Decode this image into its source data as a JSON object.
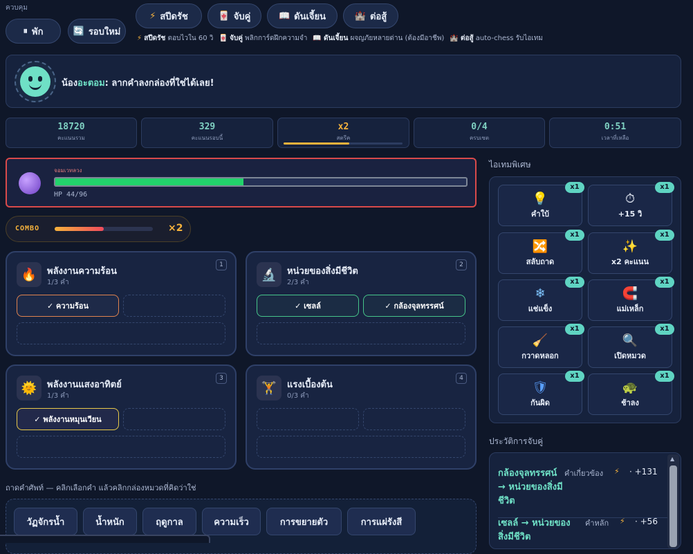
{
  "controls": {
    "label": "ควบคุม",
    "pause": "พัก",
    "restart": "รอบใหม่"
  },
  "modes": [
    {
      "icon": "⚡",
      "label": "สปีดรัช"
    },
    {
      "icon": "🀄",
      "label": "จับคู่"
    },
    {
      "icon": "📖",
      "label": "ดันเจี้ยน"
    },
    {
      "icon": "🏰",
      "label": "ต่อสู้"
    }
  ],
  "mode_hints": [
    {
      "icon": "⚡",
      "name": "สปีดรัช",
      "desc": "ตอบไวใน 60 วิ"
    },
    {
      "icon": "🀄",
      "name": "จับคู่",
      "desc": "พลิกการ์ดฝึกความจำ"
    },
    {
      "icon": "📖",
      "name": "ดันเจี้ยน",
      "desc": "ผจญภัยหลายด่าน (ต้องมีอาชีพ)"
    },
    {
      "icon": "🏰",
      "name": "ต่อสู้",
      "desc": "auto-chess รับไอเทม"
    }
  ],
  "mascot": {
    "prefix": "น้อง",
    "name": "อะตอม",
    "message": ": ลากคำลงกล่องที่ใช่ได้เลย!"
  },
  "stats": [
    {
      "value": "18720",
      "label": "คะแนนรวม"
    },
    {
      "value": "329",
      "label": "คะแนนรอบนี้"
    },
    {
      "value": "x2",
      "label": "สตรีค",
      "progress": 0.55
    },
    {
      "value": "0/4",
      "label": "ครบเซต"
    },
    {
      "value": "0:51",
      "label": "เวลาที่เหลือ"
    }
  ],
  "boss": {
    "name": "จอมเวทลวง",
    "hp": "HP 44/96",
    "hp_fraction": 0.458
  },
  "combo": {
    "label": "COMBO",
    "multiplier": "×2",
    "fraction": 0.5
  },
  "categories": [
    {
      "num": "1",
      "icon": "🔥",
      "title": "พลังงานความร้อน",
      "count": "1/3 คำ",
      "filled": [
        "✓ ความร้อน"
      ]
    },
    {
      "num": "2",
      "icon": "🔬",
      "title": "หน่วยของสิ่งมีชีวิต",
      "count": "2/3 คำ",
      "filled": [
        "✓ เซลล์",
        "✓ กล้องจุลทรรศน์"
      ]
    },
    {
      "num": "3",
      "icon": "🌞",
      "title": "พลังงานแสงอาทิตย์",
      "count": "1/3 คำ",
      "filled": [
        "✓ พลังงานหมุนเวียน"
      ]
    },
    {
      "num": "4",
      "icon": "🏋",
      "title": "แรงเบื้องต้น",
      "count": "0/3 คำ",
      "filled": []
    }
  ],
  "items_title": "ไอเทมพิเศษ",
  "items": [
    {
      "icon": "💡",
      "label": "คำใบ้",
      "count": "x1"
    },
    {
      "icon": "⏱",
      "label": "+15 วิ",
      "count": "x1"
    },
    {
      "icon": "🔀",
      "label": "สลับถาด",
      "count": "x1"
    },
    {
      "icon": "✨",
      "label": "x2 คะแนน",
      "count": "x1"
    },
    {
      "icon": "❄",
      "label": "แช่แข็ง",
      "count": "x1"
    },
    {
      "icon": "🧲",
      "label": "แม่เหล็ก",
      "count": "x1"
    },
    {
      "icon": "🧹",
      "label": "กวาดหลอก",
      "count": "x1"
    },
    {
      "icon": "🔍",
      "label": "เปิดหมวด",
      "count": "x1"
    },
    {
      "icon": "🛡",
      "label": "กันผิด",
      "count": "x1"
    },
    {
      "icon": "🐢",
      "label": "ช้าลง",
      "count": "x1"
    }
  ],
  "history_title": "ประวัติการจับคู่",
  "history": [
    {
      "match": "กล้องจุลทรรศน์ → หน่วยของสิ่งมีชีวิต",
      "tag": "คำเกี่ยวข้อง",
      "bolt": "⚡",
      "points": "· +131"
    },
    {
      "match": "เซลล์ → หน่วยของสิ่งมีชีวิต",
      "tag": "คำหลัก",
      "bolt": "⚡",
      "points": "· +56"
    }
  ],
  "tray": {
    "label": "ถาดคำศัพท์ — คลิกเลือกคำ แล้วคลิกกล่องหมวดที่คิดว่าใช่",
    "words": [
      "วัฏจักรน้ำ",
      "น้ำหนัก",
      "ฤดูกาล",
      "ความเร็ว",
      "การขยายตัว",
      "การแผ่รังสี"
    ]
  }
}
